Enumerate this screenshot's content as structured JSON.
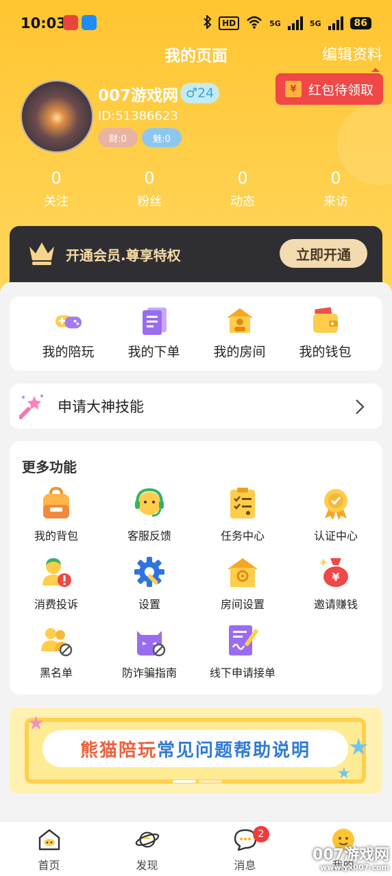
{
  "status_bar": {
    "time": "10:03",
    "hd_label": "HD",
    "net1": "5G",
    "net2": "5G",
    "battery": "86"
  },
  "header": {
    "title": "我的页面",
    "edit_label": "编辑资料",
    "red_packet_label": "红包待领取",
    "red_packet_icon": "¥"
  },
  "profile": {
    "username": "007游戏网",
    "gender_badge": "♂24",
    "user_id": "ID:51386623",
    "wealth_badge": "财:0",
    "charm_badge": "魅:0"
  },
  "stats": [
    {
      "value": "0",
      "label": "关注"
    },
    {
      "value": "0",
      "label": "粉丝"
    },
    {
      "value": "0",
      "label": "动态"
    },
    {
      "value": "0",
      "label": "来访"
    }
  ],
  "vip": {
    "text": "开通会员.尊享特权",
    "button": "立即开通"
  },
  "quick_actions": [
    {
      "label": "我的陪玩",
      "icon": "gamepad-icon"
    },
    {
      "label": "我的下单",
      "icon": "order-icon"
    },
    {
      "label": "我的房间",
      "icon": "room-icon"
    },
    {
      "label": "我的钱包",
      "icon": "wallet-icon"
    }
  ],
  "apply": {
    "label": "申请大神技能",
    "icon": "magic-wand-icon"
  },
  "more": {
    "title": "更多功能",
    "items": [
      {
        "label": "我的背包",
        "icon": "backpack-icon"
      },
      {
        "label": "客服反馈",
        "icon": "customer-service-icon"
      },
      {
        "label": "任务中心",
        "icon": "task-icon"
      },
      {
        "label": "认证中心",
        "icon": "certification-icon"
      },
      {
        "label": "消费投诉",
        "icon": "complaint-icon"
      },
      {
        "label": "设置",
        "icon": "settings-gear-icon"
      },
      {
        "label": "房间设置",
        "icon": "room-settings-icon"
      },
      {
        "label": "邀请赚钱",
        "icon": "money-bag-icon"
      },
      {
        "label": "黑名单",
        "icon": "blacklist-icon"
      },
      {
        "label": "防诈骗指南",
        "icon": "anti-fraud-icon"
      },
      {
        "label": "线下申请接单",
        "icon": "offline-apply-icon"
      }
    ]
  },
  "banner": {
    "part1": "熊猫陪玩",
    "part2": "常见问题帮助说明"
  },
  "tabbar": {
    "items": [
      {
        "label": "首页",
        "icon": "home-icon"
      },
      {
        "label": "发现",
        "icon": "discover-icon"
      },
      {
        "label": "消息",
        "icon": "message-icon",
        "badge": "2"
      },
      {
        "label": "我的",
        "icon": "profile-icon"
      }
    ]
  },
  "watermark": {
    "text": "007游戏网",
    "url": "www.yx007.com"
  },
  "colors": {
    "header_yellow": "#ffc531",
    "vip_dark": "#2f2e33",
    "red_packet": "#f04747",
    "badge_red": "#f43a3a"
  }
}
